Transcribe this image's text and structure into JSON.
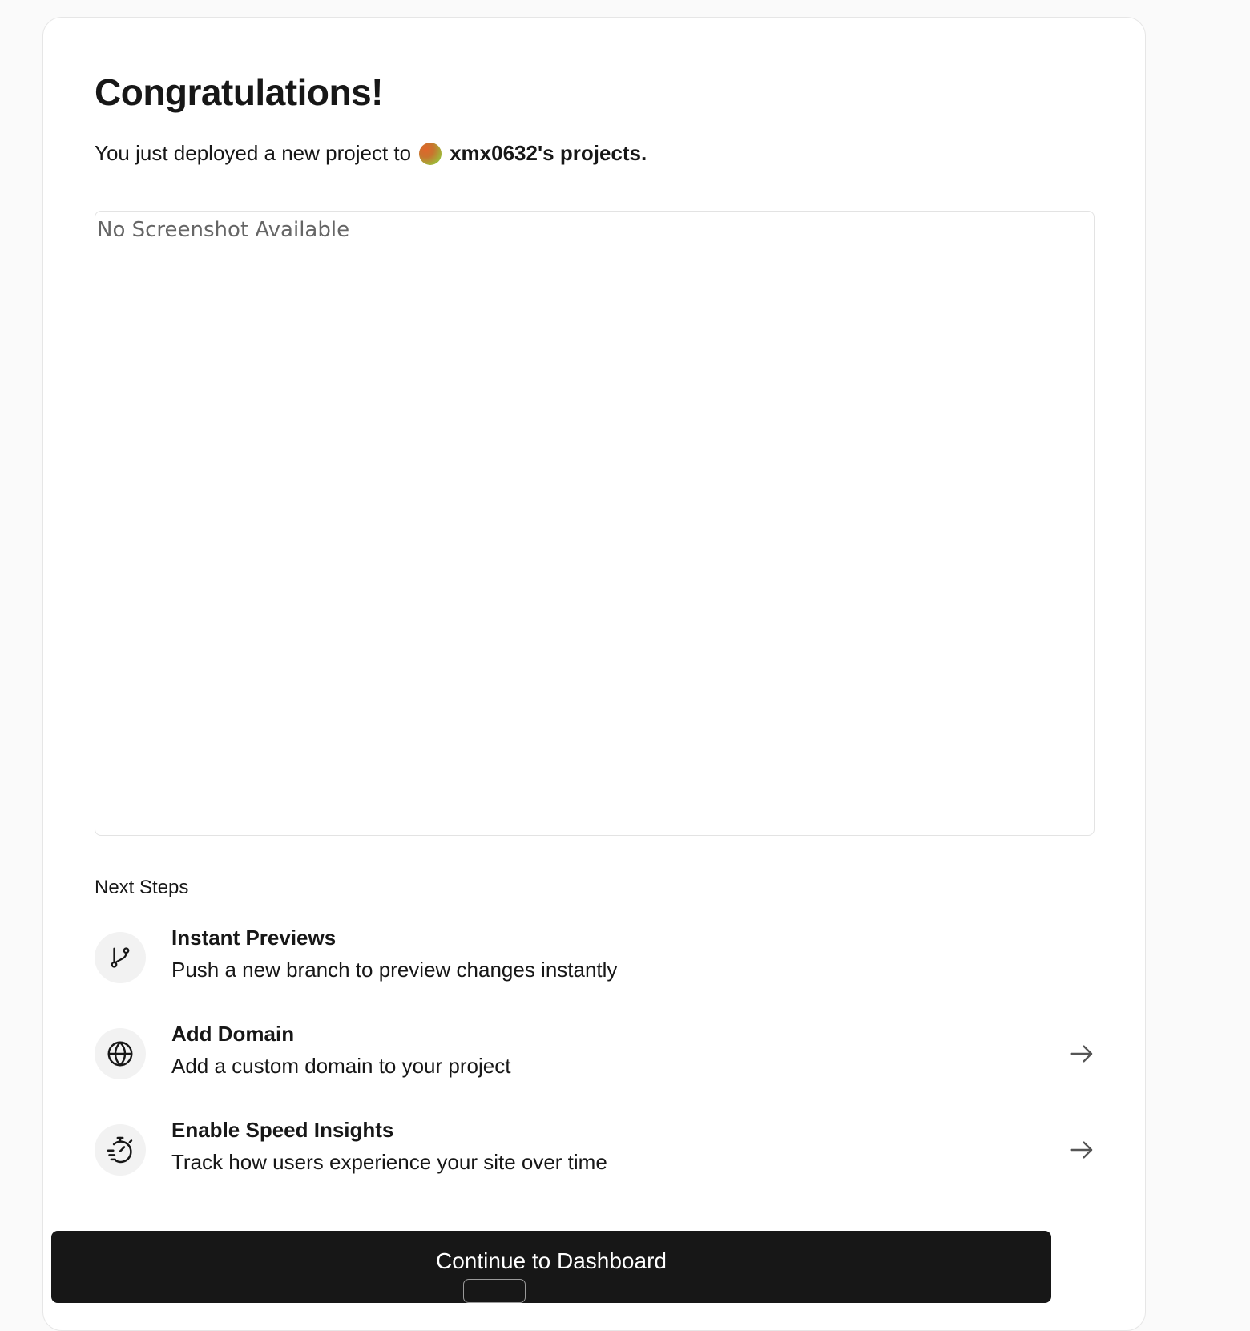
{
  "heading": "Congratulations!",
  "subtitle": {
    "prefix": "You just deployed a new project to",
    "team_name": "xmx0632's projects."
  },
  "preview": {
    "placeholder": "No Screenshot Available"
  },
  "next_steps": {
    "heading": "Next Steps",
    "items": [
      {
        "title": "Instant Previews",
        "description": "Push a new branch to preview changes instantly",
        "icon": "git-branch-icon",
        "has_arrow": false
      },
      {
        "title": "Add Domain",
        "description": "Add a custom domain to your project",
        "icon": "globe-icon",
        "has_arrow": true
      },
      {
        "title": "Enable Speed Insights",
        "description": "Track how users experience your site over time",
        "icon": "stopwatch-speed-icon",
        "has_arrow": true
      }
    ]
  },
  "cta": {
    "label": "Continue to Dashboard"
  },
  "colors": {
    "page_background": "#fafafa",
    "card_background": "#ffffff",
    "text_primary": "#171717",
    "text_muted": "#666666",
    "button_background": "#171717",
    "icon_circle": "#f2f2f2"
  }
}
